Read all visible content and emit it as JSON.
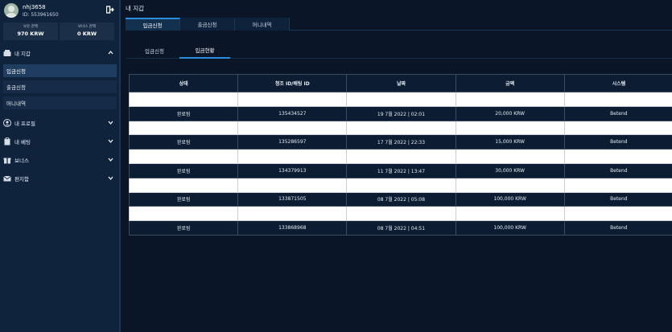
{
  "user": {
    "username": "nhj3658",
    "id_line": "ID: 553961650"
  },
  "balances": [
    {
      "label": "보유 잔액",
      "value": "970 KRW"
    },
    {
      "label": "보너스 잔액",
      "value": "0 KRW"
    }
  ],
  "sidebar": {
    "wallet": {
      "label": "내 지갑",
      "items": [
        "입금신청",
        "출금신청",
        "머니내역"
      ]
    },
    "profile": {
      "label": "내 프로필"
    },
    "betting": {
      "label": "내 베팅"
    },
    "bonus": {
      "label": "보너스"
    },
    "mailbox": {
      "label": "편지함"
    }
  },
  "page": {
    "title": "내 지갑"
  },
  "tabs": [
    "입금신청",
    "출금신청",
    "머니내역"
  ],
  "subtabs": [
    "입금신청",
    "입금현황"
  ],
  "table": {
    "headers": [
      "상태",
      "청조 ID/배팅 ID",
      "날짜",
      "금액",
      "시스템"
    ],
    "rows": [
      [
        "완료됨",
        "135434527",
        "19 7월 2022 | 02:01",
        "20,000 KRW",
        "Betend"
      ],
      [
        "완료됨",
        "135286597",
        "17 7월 2022 | 22:33",
        "15,000 KRW",
        "Betend"
      ],
      [
        "완료됨",
        "134379913",
        "11 7월 2022 | 13:47",
        "30,000 KRW",
        "Betend"
      ],
      [
        "완료됨",
        "133871505",
        "08 7월 2022 | 05:08",
        "100,000 KRW",
        "Betend"
      ],
      [
        "완료됨",
        "133868968",
        "08 7월 2022 | 04:51",
        "100,000 KRW",
        "Betend"
      ]
    ]
  }
}
